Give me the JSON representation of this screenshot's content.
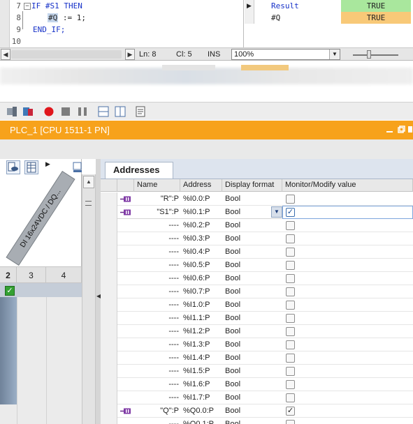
{
  "editor": {
    "lines": [
      {
        "num": "7",
        "tokens": [
          {
            "t": "IF ",
            "kw": true
          },
          {
            "t": "#S1 ",
            "kw": true
          },
          {
            "t": "THEN",
            "kw": true
          }
        ]
      },
      {
        "num": "8",
        "tokens": [
          {
            "t": "#Q",
            "hl": true
          },
          {
            "t": " := 1;"
          }
        ]
      },
      {
        "num": "9",
        "tokens": [
          {
            "t": "END_IF;",
            "kw": true
          }
        ]
      },
      {
        "num": "10",
        "tokens": []
      }
    ]
  },
  "watch": [
    {
      "name": "Result",
      "value": "TRUE",
      "name_color": "#1530c8",
      "value_bg": "#a9e79d"
    },
    {
      "name": "#Q",
      "value": "TRUE",
      "name_color": "#222222",
      "value_bg": "#f8c978"
    }
  ],
  "status": {
    "ln": "Ln: 8",
    "col": "Cl: 5",
    "mode": "INS",
    "zoom": "100%"
  },
  "header": {
    "title": "PLC_1 [CPU 1511-1 PN]",
    "accent": "#f7a21b"
  },
  "device": {
    "module_label": "DI 16x24VDC / DQ...",
    "slots": [
      "2",
      "3",
      "4"
    ]
  },
  "addresses": {
    "tab": "Addresses",
    "columns": [
      "Name",
      "Address",
      "Display format",
      "Monitor/Modify value"
    ],
    "rows": [
      {
        "name": "\"R\":P",
        "address": "%I0.0:P",
        "format": "Bool",
        "icon": true,
        "checked": false
      },
      {
        "name": "\"S1\":P",
        "address": "%I0.1:P",
        "format": "Bool",
        "icon": true,
        "checked": true,
        "selected": true
      },
      {
        "name": "----",
        "address": "%I0.2:P",
        "format": "Bool",
        "icon": false,
        "checked": false
      },
      {
        "name": "----",
        "address": "%I0.3:P",
        "format": "Bool",
        "icon": false,
        "checked": false
      },
      {
        "name": "----",
        "address": "%I0.4:P",
        "format": "Bool",
        "icon": false,
        "checked": false
      },
      {
        "name": "----",
        "address": "%I0.5:P",
        "format": "Bool",
        "icon": false,
        "checked": false
      },
      {
        "name": "----",
        "address": "%I0.6:P",
        "format": "Bool",
        "icon": false,
        "checked": false
      },
      {
        "name": "----",
        "address": "%I0.7:P",
        "format": "Bool",
        "icon": false,
        "checked": false
      },
      {
        "name": "----",
        "address": "%I1.0:P",
        "format": "Bool",
        "icon": false,
        "checked": false
      },
      {
        "name": "----",
        "address": "%I1.1:P",
        "format": "Bool",
        "icon": false,
        "checked": false
      },
      {
        "name": "----",
        "address": "%I1.2:P",
        "format": "Bool",
        "icon": false,
        "checked": false
      },
      {
        "name": "----",
        "address": "%I1.3:P",
        "format": "Bool",
        "icon": false,
        "checked": false
      },
      {
        "name": "----",
        "address": "%I1.4:P",
        "format": "Bool",
        "icon": false,
        "checked": false
      },
      {
        "name": "----",
        "address": "%I1.5:P",
        "format": "Bool",
        "icon": false,
        "checked": false
      },
      {
        "name": "----",
        "address": "%I1.6:P",
        "format": "Bool",
        "icon": false,
        "checked": false
      },
      {
        "name": "----",
        "address": "%I1.7:P",
        "format": "Bool",
        "icon": false,
        "checked": false
      },
      {
        "name": "\"Q\":P",
        "address": "%Q0.0:P",
        "format": "Bool",
        "icon": true,
        "checked": true
      },
      {
        "name": "----",
        "address": "%Q0.1:P",
        "format": "Bool",
        "icon": false,
        "checked": false
      }
    ]
  }
}
